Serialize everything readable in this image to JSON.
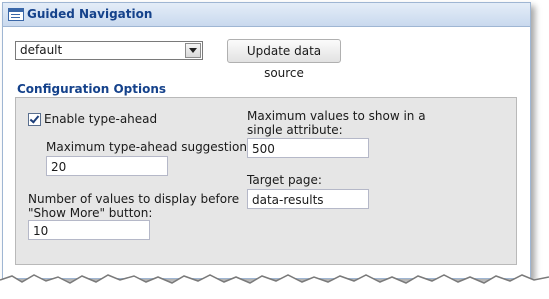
{
  "window": {
    "title": "Guided Navigation",
    "icon": "panel-icon"
  },
  "datasource": {
    "selected": "default",
    "update_button": "Update data source"
  },
  "config": {
    "section_title": "Configuration Options",
    "enable_typeahead": {
      "label": "Enable type-ahead",
      "checked": true
    },
    "max_suggestions": {
      "label": "Maximum type-ahead suggestions:",
      "value": "20"
    },
    "values_before_show_more": {
      "label": "Number of values to display before \"Show More\" button:",
      "value": "10"
    },
    "max_values_single_attribute": {
      "label": "Maximum values to show in a single attribute:",
      "value": "500"
    },
    "target_page": {
      "label": "Target page:",
      "value": "data-results"
    }
  },
  "colors": {
    "title_text": "#15428b",
    "titlebar_bg": "#c9d9ee",
    "options_bg": "#e6e6e6"
  }
}
